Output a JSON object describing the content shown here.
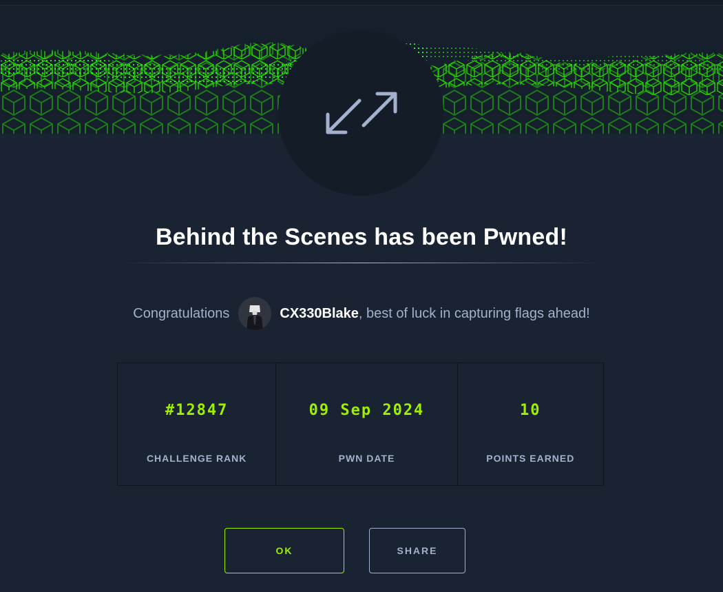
{
  "modal": {
    "title": "Behind the Scenes has been Pwned!",
    "congrats_prefix": "Congratulations",
    "username": "CX330Blake",
    "congrats_suffix": ", best of luck in capturing flags ahead!",
    "icon": "expand-arrows-icon"
  },
  "stats": [
    {
      "value": "#12847",
      "label": "CHALLENGE RANK"
    },
    {
      "value": "09 Sep 2024",
      "label": "PWN DATE"
    },
    {
      "value": "10",
      "label": "POINTS EARNED"
    }
  ],
  "buttons": {
    "ok_label": "OK",
    "share_label": "SHARE"
  },
  "colors": {
    "accent": "#9fef00",
    "background": "#1a2332",
    "text_muted": "#a4b1cd"
  }
}
